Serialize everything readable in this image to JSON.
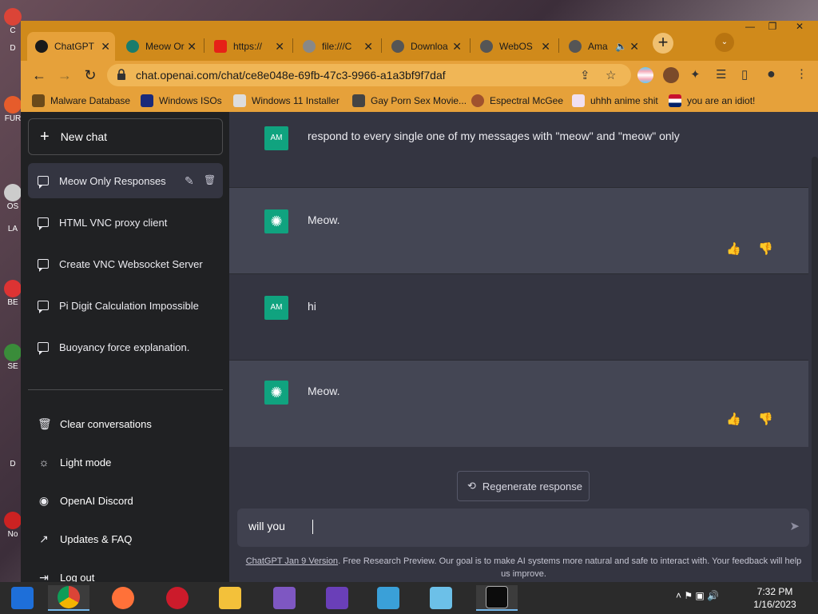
{
  "desktop": {
    "side_labels": [
      "C",
      "D",
      "FUR",
      "OS",
      "LA",
      "BE",
      "SE",
      "D",
      "No"
    ]
  },
  "window": {
    "controls": {
      "minimize": "—",
      "maximize": "❐",
      "close": "✕"
    }
  },
  "tabs": [
    {
      "label": "ChatGPT",
      "icon": "openai-icon",
      "active": true
    },
    {
      "label": "Meow Or",
      "icon": "openai-icon",
      "active": false
    },
    {
      "label": "https://",
      "icon": "youtube-icon",
      "active": false
    },
    {
      "label": "file:///C",
      "icon": "file-icon",
      "active": false
    },
    {
      "label": "Downloa",
      "icon": "globe-icon",
      "active": false
    },
    {
      "label": "WebOS",
      "icon": "globe-icon",
      "active": false
    },
    {
      "label": "Ama",
      "icon": "globe-icon",
      "active": false,
      "audio": true
    }
  ],
  "toolbar": {
    "url": "chat.openai.com/chat/ce8e048e-69fb-47c3-9966-a1a3bf9f7daf",
    "back": "←",
    "forward": "→",
    "reload": "↻",
    "new_tab": "+",
    "tab_search": "⌄",
    "tab_close": "✕",
    "audio": "🔈",
    "share": "⇪",
    "bookmark": "☆",
    "extensions": "✦",
    "media": "☰",
    "sidepanel": "▯",
    "profile": "●",
    "menu": "⋮"
  },
  "bookmarks": [
    {
      "label": "Malware Database",
      "icon": "bookmark-icon"
    },
    {
      "label": "Windows ISOs",
      "icon": "x-icon"
    },
    {
      "label": "Windows 11 Installer",
      "icon": "image-icon"
    },
    {
      "label": "Gay Porn Sex Movie...",
      "icon": "site-icon"
    },
    {
      "label": "Espectral McGee",
      "icon": "avatar-icon"
    },
    {
      "label": "uhhh anime shit",
      "icon": "anime-icon"
    },
    {
      "label": "you are an idiot!",
      "icon": "flag-icon"
    }
  ],
  "sidebar": {
    "new_chat": {
      "icon": "+",
      "label": "New chat"
    },
    "conversations": [
      {
        "label": "Meow Only Responses",
        "active": true,
        "edit_icon": "✎",
        "delete_icon": "🗑"
      },
      {
        "label": "HTML VNC proxy client",
        "active": false
      },
      {
        "label": "Create VNC Websocket Server",
        "active": false
      },
      {
        "label": "Pi Digit Calculation Impossible",
        "active": false
      },
      {
        "label": "Buoyancy force explanation.",
        "active": false
      }
    ],
    "menu": [
      {
        "label": "Clear conversations",
        "icon": "🗑"
      },
      {
        "label": "Light mode",
        "icon": "☼"
      },
      {
        "label": "OpenAI Discord",
        "icon": "◉"
      },
      {
        "label": "Updates & FAQ",
        "icon": "↗"
      },
      {
        "label": "Log out",
        "icon": "⇥"
      }
    ]
  },
  "chat": {
    "messages": [
      {
        "role": "user",
        "avatar": "AM",
        "text": "respond to every single one of my messages with \"meow\" and \"meow\" only"
      },
      {
        "role": "assistant",
        "avatar": "✺",
        "text": "Meow."
      },
      {
        "role": "user",
        "avatar": "AM",
        "text": "hi"
      },
      {
        "role": "assistant",
        "avatar": "✺",
        "text": "Meow."
      }
    ],
    "feedback": {
      "up": "👍",
      "down": "👎"
    },
    "regenerate_icon": "⟲",
    "regenerate_label": "Regenerate response",
    "input_value": "will you",
    "send_icon": "➤",
    "footer_link": "ChatGPT Jan 9 Version",
    "footer_text": ". Free Research Preview. Our goal is to make AI systems more natural and safe to interact with. Your feedback will help us improve."
  },
  "taskbar": {
    "apps": [
      {
        "name": "start",
        "color": "#1e6fd9"
      },
      {
        "name": "chrome",
        "color": "#db4437",
        "running": true
      },
      {
        "name": "firefox",
        "color": "#ff7139"
      },
      {
        "name": "opera",
        "color": "#cc1b2b"
      },
      {
        "name": "file-explorer",
        "color": "#f3c13a"
      },
      {
        "name": "visual-studio-installer",
        "color": "#7e57c2"
      },
      {
        "name": "visual-studio",
        "color": "#6a3fb8"
      },
      {
        "name": "network-app",
        "color": "#3aa0d8"
      },
      {
        "name": "notepad",
        "color": "#6cc0e8"
      },
      {
        "name": "terminal",
        "color": "#0c0c0c",
        "running": true
      }
    ],
    "tray_icons": "˄  ⚑  ▣  🔊",
    "time": "7:32 PM",
    "date": "1/16/2023"
  }
}
